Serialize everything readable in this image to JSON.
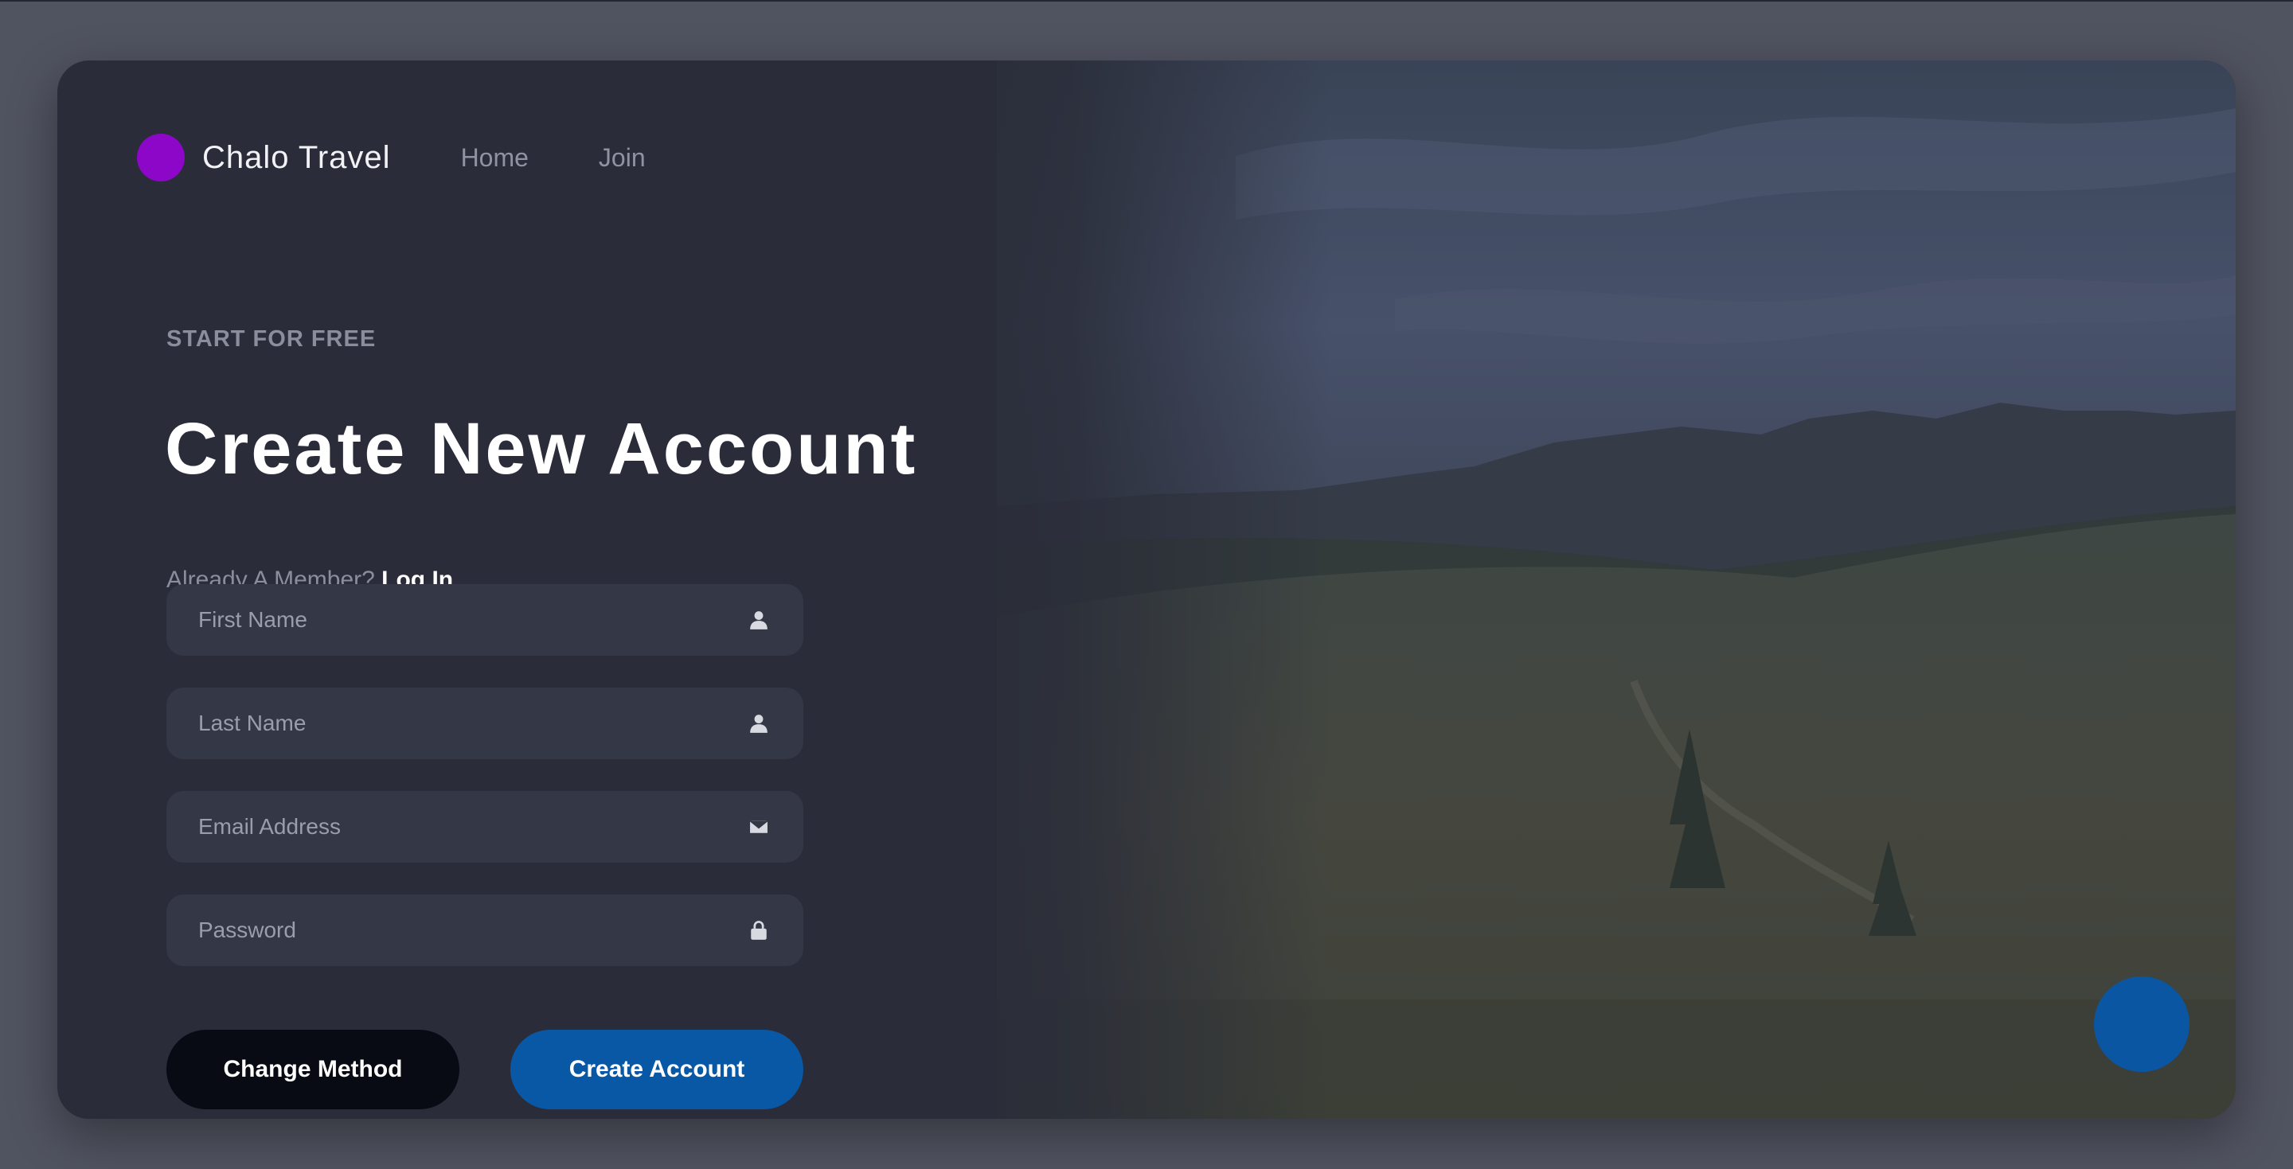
{
  "nav": {
    "brand": "Chalo Travel",
    "links": [
      "Home",
      "Join"
    ]
  },
  "hero": {
    "eyebrow": "START FOR FREE",
    "title": "Create New Account",
    "member_prompt": "Already A Member?",
    "login_link": "Log In"
  },
  "form": {
    "first_name": {
      "placeholder": "First Name",
      "value": "",
      "icon": "user-icon"
    },
    "last_name": {
      "placeholder": "Last Name",
      "value": "",
      "icon": "user-icon"
    },
    "email": {
      "placeholder": "Email Address",
      "value": "",
      "icon": "envelope-icon"
    },
    "password": {
      "placeholder": "Password",
      "value": "",
      "icon": "lock-icon"
    }
  },
  "actions": {
    "change_method": "Change Method",
    "create_account": "Create Account"
  },
  "colors": {
    "accent_purple": "#8d07c8",
    "primary_blue": "#0858a6",
    "dark_button": "#080b14",
    "card_background": "#2a2d39",
    "page_background": "#505360"
  }
}
